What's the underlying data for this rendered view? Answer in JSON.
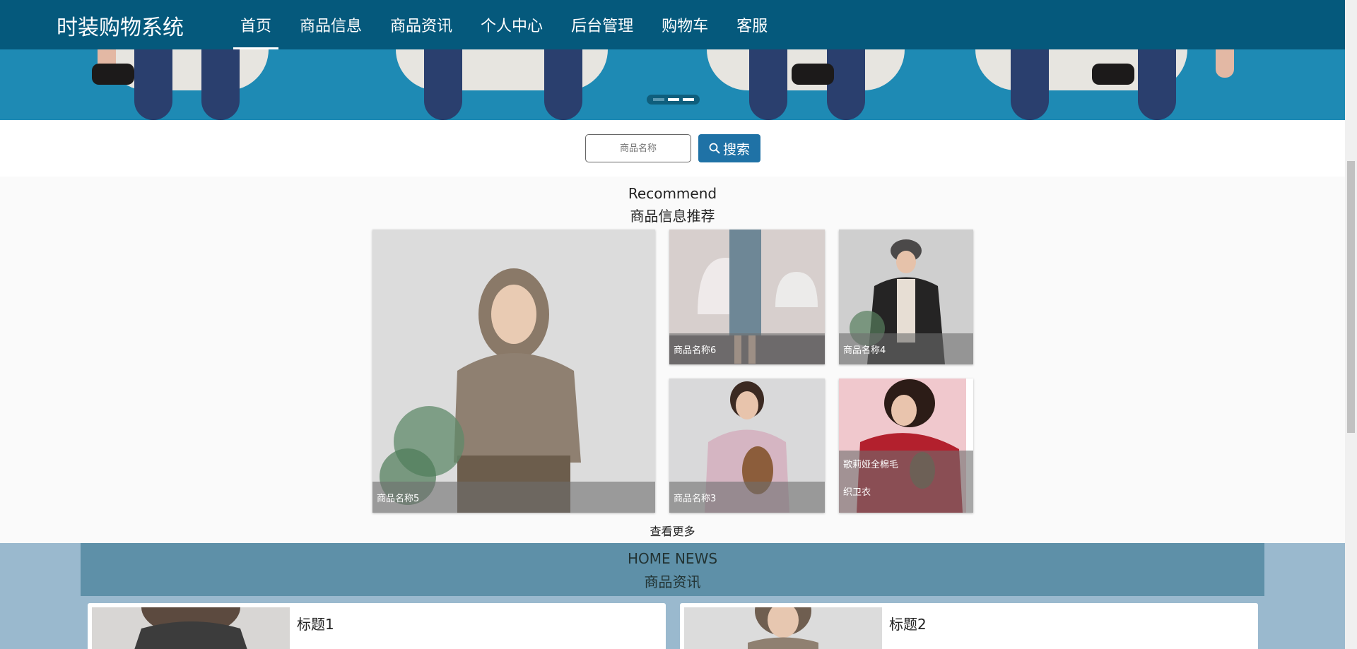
{
  "nav": {
    "brand": "时装购物系统",
    "items": [
      {
        "label": "首页",
        "active": true
      },
      {
        "label": "商品信息",
        "active": false
      },
      {
        "label": "商品资讯",
        "active": false
      },
      {
        "label": "个人中心",
        "active": false
      },
      {
        "label": "后台管理",
        "active": false
      },
      {
        "label": "购物车",
        "active": false
      },
      {
        "label": "客服",
        "active": false
      }
    ]
  },
  "search": {
    "placeholder": "商品名称",
    "button_label": "搜索"
  },
  "recommend": {
    "title_en": "Recommend",
    "title_cn": "商品信息推荐",
    "items": [
      {
        "name": "商品名称5"
      },
      {
        "name": "商品名称6"
      },
      {
        "name": "商品名称4"
      },
      {
        "name": "商品名称3"
      },
      {
        "name_line1": "歌莉娅全棉毛",
        "name_line2": "织卫衣"
      }
    ],
    "more_label": "查看更多"
  },
  "news": {
    "title_en": "HOME NEWS",
    "title_cn": "商品资讯",
    "items": [
      {
        "title": "标题1"
      },
      {
        "title": "标题2"
      }
    ]
  },
  "colors": {
    "nav_bg": "#05597c",
    "accent_button": "#1f72a6",
    "news_bg": "#9ab9ce",
    "news_header": "#5e90a8"
  }
}
